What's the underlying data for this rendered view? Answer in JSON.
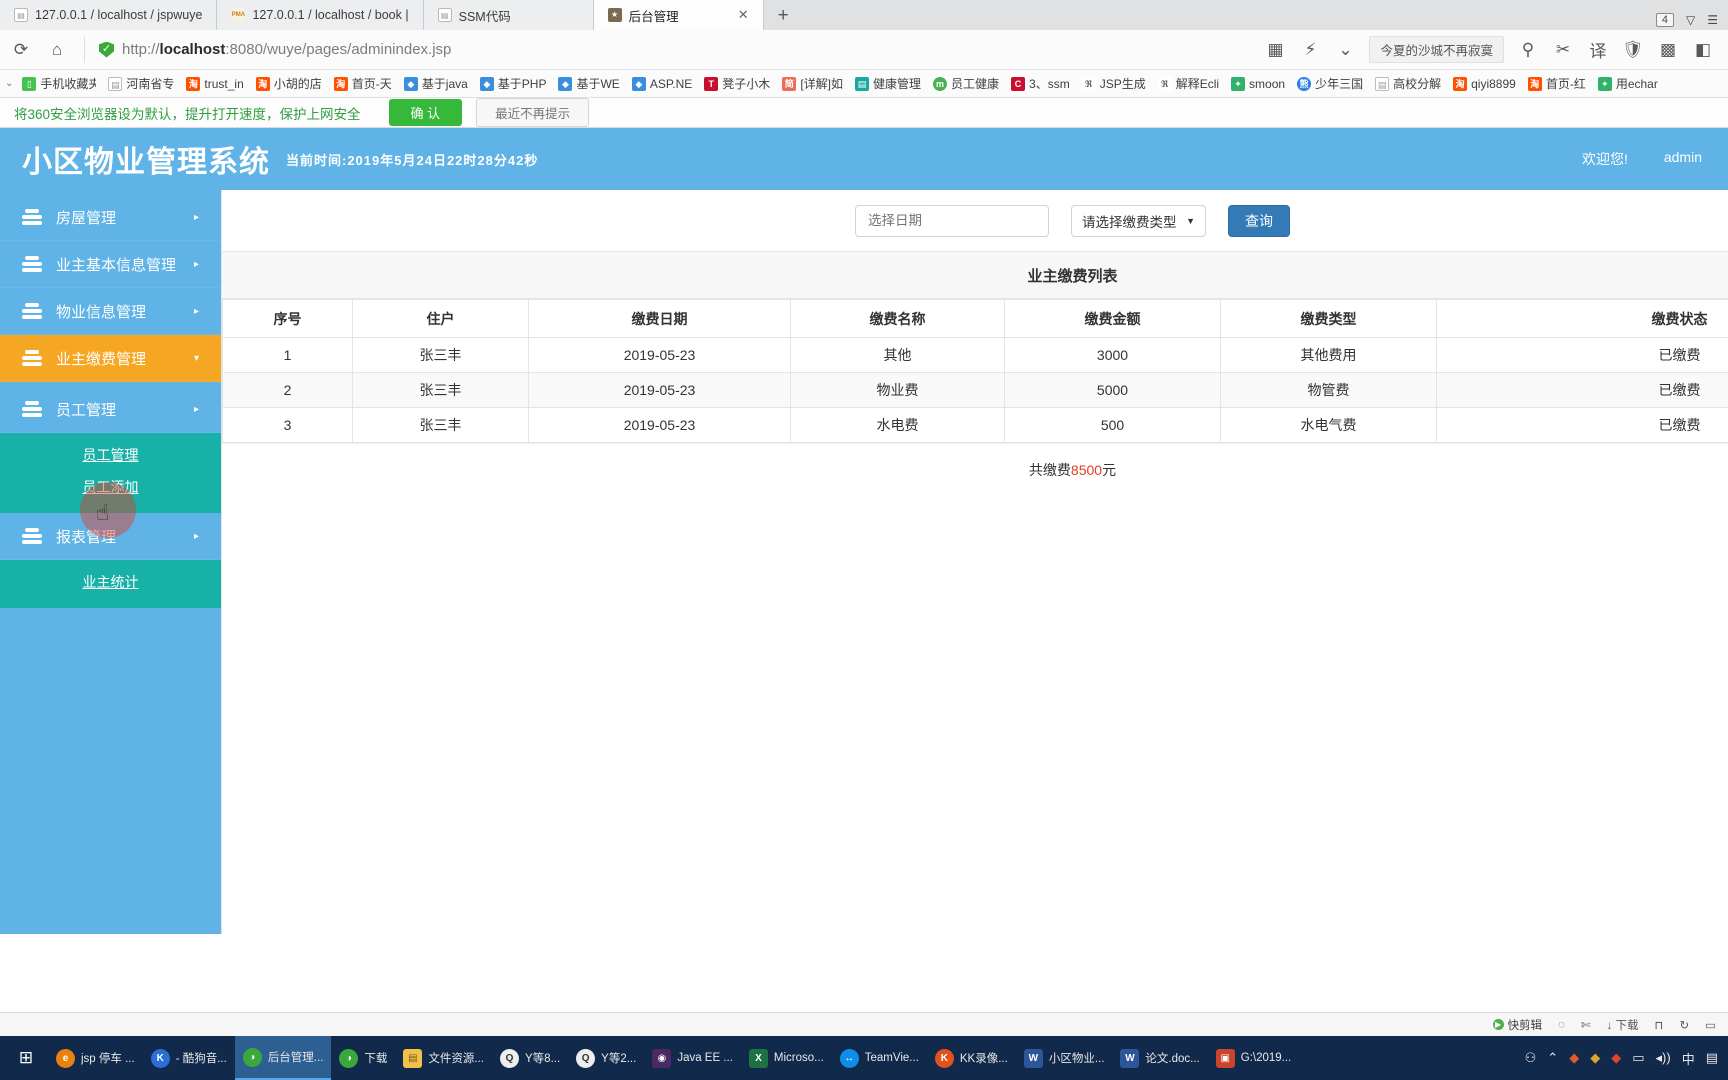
{
  "browser": {
    "tabs": [
      {
        "title": "127.0.0.1 / localhost / jspwuye",
        "icon": "doc-icon",
        "active": false
      },
      {
        "title": "127.0.0.1 / localhost / book |",
        "icon": "phpmyadmin-icon",
        "active": false
      },
      {
        "title": "SSM代码",
        "icon": "doc-icon",
        "active": false
      },
      {
        "title": "后台管理",
        "icon": "admin-icon",
        "active": true
      }
    ],
    "new_tab_label": "+",
    "tab_close_label": "✕",
    "window_count": "4",
    "window_controls": [
      "favorites-icon",
      "menu-icon"
    ],
    "nav": {
      "back_icon": "back-arrow-icon",
      "reload_icon": "reload-icon",
      "home_icon": "home-icon",
      "url_prefix": "http://",
      "url_host": "localhost",
      "url_rest": ":8080/wuye/pages/adminindex.jsp",
      "search_placeholder": "今夏的沙城不再寂寞",
      "search_icon": "search-icon",
      "right_icons": [
        "scissors-icon",
        "translate-icon",
        "shield-icon",
        "grid-icon",
        "user-icon"
      ]
    },
    "bookmarks": [
      {
        "label": "手机收藏夹",
        "icon": "phone-icon",
        "color": "#46c152"
      },
      {
        "label": "河南省专",
        "icon": "doc-icon",
        "color": "#ffffff"
      },
      {
        "label": "trust_in",
        "icon": "taobao-icon",
        "color": "#ff5000"
      },
      {
        "label": "小胡的店",
        "icon": "taobao-icon",
        "color": "#ff5000"
      },
      {
        "label": "首页-天",
        "icon": "taobao-icon",
        "color": "#ff5000"
      },
      {
        "label": "基于java",
        "icon": "blue-doc-icon",
        "color": "#3b8ede"
      },
      {
        "label": "基于PHP",
        "icon": "blue-doc-icon",
        "color": "#3b8ede"
      },
      {
        "label": "基于WE",
        "icon": "blue-doc-icon",
        "color": "#3b8ede"
      },
      {
        "label": "ASP.NE",
        "icon": "blue-doc-icon",
        "color": "#3b8ede"
      },
      {
        "label": "凳子小木",
        "icon": "tianmao-icon",
        "color": "#c8102e"
      },
      {
        "label": "[详解]如",
        "icon": "jianshu-icon",
        "color": "#ea6f5a"
      },
      {
        "label": "健康管理",
        "icon": "teal-icon",
        "color": "#1aa9a2"
      },
      {
        "label": "员工健康",
        "icon": "green-icon",
        "color": "#4caf50"
      },
      {
        "label": "3、ssm",
        "icon": "csdn-icon",
        "color": "#c8102e"
      },
      {
        "label": "JSP生成",
        "icon": "cnblogs-icon",
        "color": "#ffffff"
      },
      {
        "label": "解释Ecli",
        "icon": "cnblogs-icon",
        "color": "#ffffff"
      },
      {
        "label": "smoon",
        "icon": "green-app-icon",
        "color": "#2fb36a"
      },
      {
        "label": "少年三国",
        "icon": "baidu-icon",
        "color": "#2b7fe0"
      },
      {
        "label": "高校分解",
        "icon": "doc-icon",
        "color": "#ffffff"
      },
      {
        "label": "qiyi8899",
        "icon": "taobao-icon",
        "color": "#ff5000"
      },
      {
        "label": "首页-红",
        "icon": "taobao-icon",
        "color": "#ff5000"
      },
      {
        "label": "用echar",
        "icon": "green-app-icon",
        "color": "#2fb36a"
      }
    ],
    "notification": {
      "text": "将360安全浏览器设为默认，提升打开速度，保护上网安全",
      "confirm_label": "确 认",
      "dismiss_label": "最近不再提示"
    }
  },
  "app": {
    "title": "小区物业管理系统",
    "current_time": "当前时间:2019年5月24日22时28分42秒",
    "welcome_label": "欢迎您!",
    "user_name": "admin",
    "sidebar": {
      "items": [
        {
          "label": "房屋管理",
          "icon": "stack-icon",
          "arrow": "▸",
          "active": false
        },
        {
          "label": "业主基本信息管理",
          "icon": "stack-icon",
          "arrow": "▸",
          "active": false
        },
        {
          "label": "物业信息管理",
          "icon": "stack-icon",
          "arrow": "▸",
          "active": false
        },
        {
          "label": "业主缴费管理",
          "icon": "stack-icon",
          "arrow": "▾",
          "active": true
        },
        {
          "label": "员工管理",
          "icon": "stack-icon",
          "arrow": "▸",
          "active": false
        }
      ],
      "staff_submenu": [
        "员工管理",
        "员工添加"
      ],
      "report_item": {
        "label": "报表管理",
        "icon": "stack-icon",
        "arrow": "▸"
      },
      "report_submenu": [
        "业主统计"
      ]
    },
    "filter": {
      "date_placeholder": "选择日期",
      "date_value": "",
      "type_selected": "请选择缴费类型",
      "type_caret": "▼",
      "query_label": "查询"
    },
    "panel_title": "业主缴费列表",
    "table": {
      "headers": [
        "序号",
        "住户",
        "缴费日期",
        "缴费名称",
        "缴费金额",
        "缴费类型",
        "缴费状态"
      ],
      "rows": [
        [
          "1",
          "张三丰",
          "2019-05-23",
          "其他",
          "3000",
          "其他费用",
          "已缴费"
        ],
        [
          "2",
          "张三丰",
          "2019-05-23",
          "物业费",
          "5000",
          "物管费",
          "已缴费"
        ],
        [
          "3",
          "张三丰",
          "2019-05-23",
          "水电费",
          "500",
          "水电气费",
          "已缴费"
        ]
      ]
    },
    "total": {
      "prefix": "共缴费",
      "amount": "8500",
      "suffix": " 元"
    }
  },
  "statusbar": {
    "items": [
      {
        "label": "快剪辑",
        "icon": "play-icon"
      },
      {
        "label": "",
        "icon": "camera-icon"
      },
      {
        "label": "",
        "icon": "pin-icon"
      },
      {
        "label": "下载",
        "icon": "download-icon"
      },
      {
        "label": "",
        "icon": "window-icon"
      },
      {
        "label": "",
        "icon": "refresh-icon"
      },
      {
        "label": "",
        "icon": "panel-icon"
      }
    ]
  },
  "taskbar": {
    "start_icon": "start-icon",
    "items": [
      {
        "label": "jsp 停车 ...",
        "icon": "firefox-icon",
        "color": "#e8820c",
        "active": false
      },
      {
        "label": "- 酷狗音...",
        "icon": "kugou-icon",
        "color": "#2a6fd6",
        "active": false
      },
      {
        "label": "后台管理...",
        "icon": "browser360-icon",
        "color": "#3aa93a",
        "active": true
      },
      {
        "label": "下载",
        "icon": "browser360-icon",
        "color": "#3aa93a",
        "active": false
      },
      {
        "label": "文件资源...",
        "icon": "folder-icon",
        "color": "#f2c14b",
        "active": false
      },
      {
        "label": "Y等8...",
        "icon": "qq-icon",
        "color": "#eeeeee",
        "active": false
      },
      {
        "label": "Y等2...",
        "icon": "qq-icon",
        "color": "#eeeeee",
        "active": false
      },
      {
        "label": "Java EE ...",
        "icon": "eclipse-icon",
        "color": "#4b2a63",
        "active": false
      },
      {
        "label": "Microso...",
        "icon": "excel-icon",
        "color": "#1e7145",
        "active": false
      },
      {
        "label": "TeamVie...",
        "icon": "teamviewer-icon",
        "color": "#0e8ee9",
        "active": false
      },
      {
        "label": "KK录像...",
        "icon": "kk-icon",
        "color": "#e0531f",
        "active": false
      },
      {
        "label": "小区物业...",
        "icon": "word-icon",
        "color": "#2b579a",
        "active": false
      },
      {
        "label": "论文.doc...",
        "icon": "word-icon",
        "color": "#2b579a",
        "active": false
      },
      {
        "label": "G:\\2019...",
        "icon": "winrar-icon",
        "color": "#c8442a",
        "active": false
      }
    ],
    "tray": [
      "person-icon",
      "chevron-up-icon",
      "tray-icon-1",
      "tray-icon-2",
      "tray-icon-3",
      "network-icon",
      "volume-icon",
      "ime-label",
      "notify-icon"
    ],
    "ime_label": "中"
  }
}
